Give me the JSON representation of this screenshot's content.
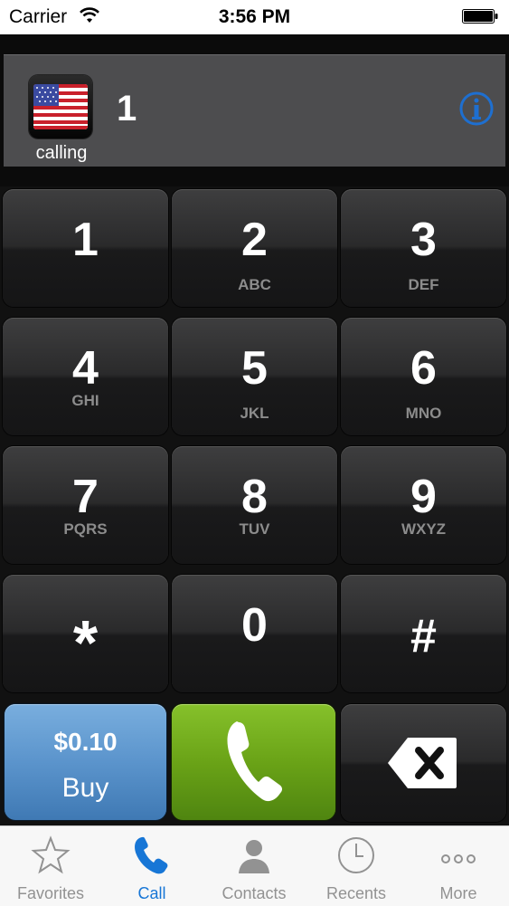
{
  "status_bar": {
    "carrier": "Carrier",
    "time": "3:56 PM"
  },
  "dial": {
    "calling_label": "calling",
    "number": "1"
  },
  "keypad": {
    "keys": [
      {
        "digit": "1",
        "letters": ""
      },
      {
        "digit": "2",
        "letters": "ABC"
      },
      {
        "digit": "3",
        "letters": "DEF"
      },
      {
        "digit": "4",
        "letters": "GHI"
      },
      {
        "digit": "5",
        "letters": "JKL"
      },
      {
        "digit": "6",
        "letters": "MNO"
      },
      {
        "digit": "7",
        "letters": "PQRS"
      },
      {
        "digit": "8",
        "letters": "TUV"
      },
      {
        "digit": "9",
        "letters": "WXYZ"
      },
      {
        "digit": "*",
        "letters": ""
      },
      {
        "digit": "0",
        "letters": ""
      },
      {
        "digit": "#",
        "letters": ""
      }
    ],
    "buy_price": "$0.10",
    "buy_label": "Buy"
  },
  "tabs": [
    {
      "label": "Favorites",
      "icon": "star-icon"
    },
    {
      "label": "Call",
      "icon": "phone-icon",
      "active": true
    },
    {
      "label": "Contacts",
      "icon": "person-icon"
    },
    {
      "label": "Recents",
      "icon": "clock-icon"
    },
    {
      "label": "More",
      "icon": "more-icon"
    }
  ],
  "colors": {
    "accent": "#1776d6",
    "call_green": "#6aa317",
    "buy_blue": "#5b94cc"
  }
}
